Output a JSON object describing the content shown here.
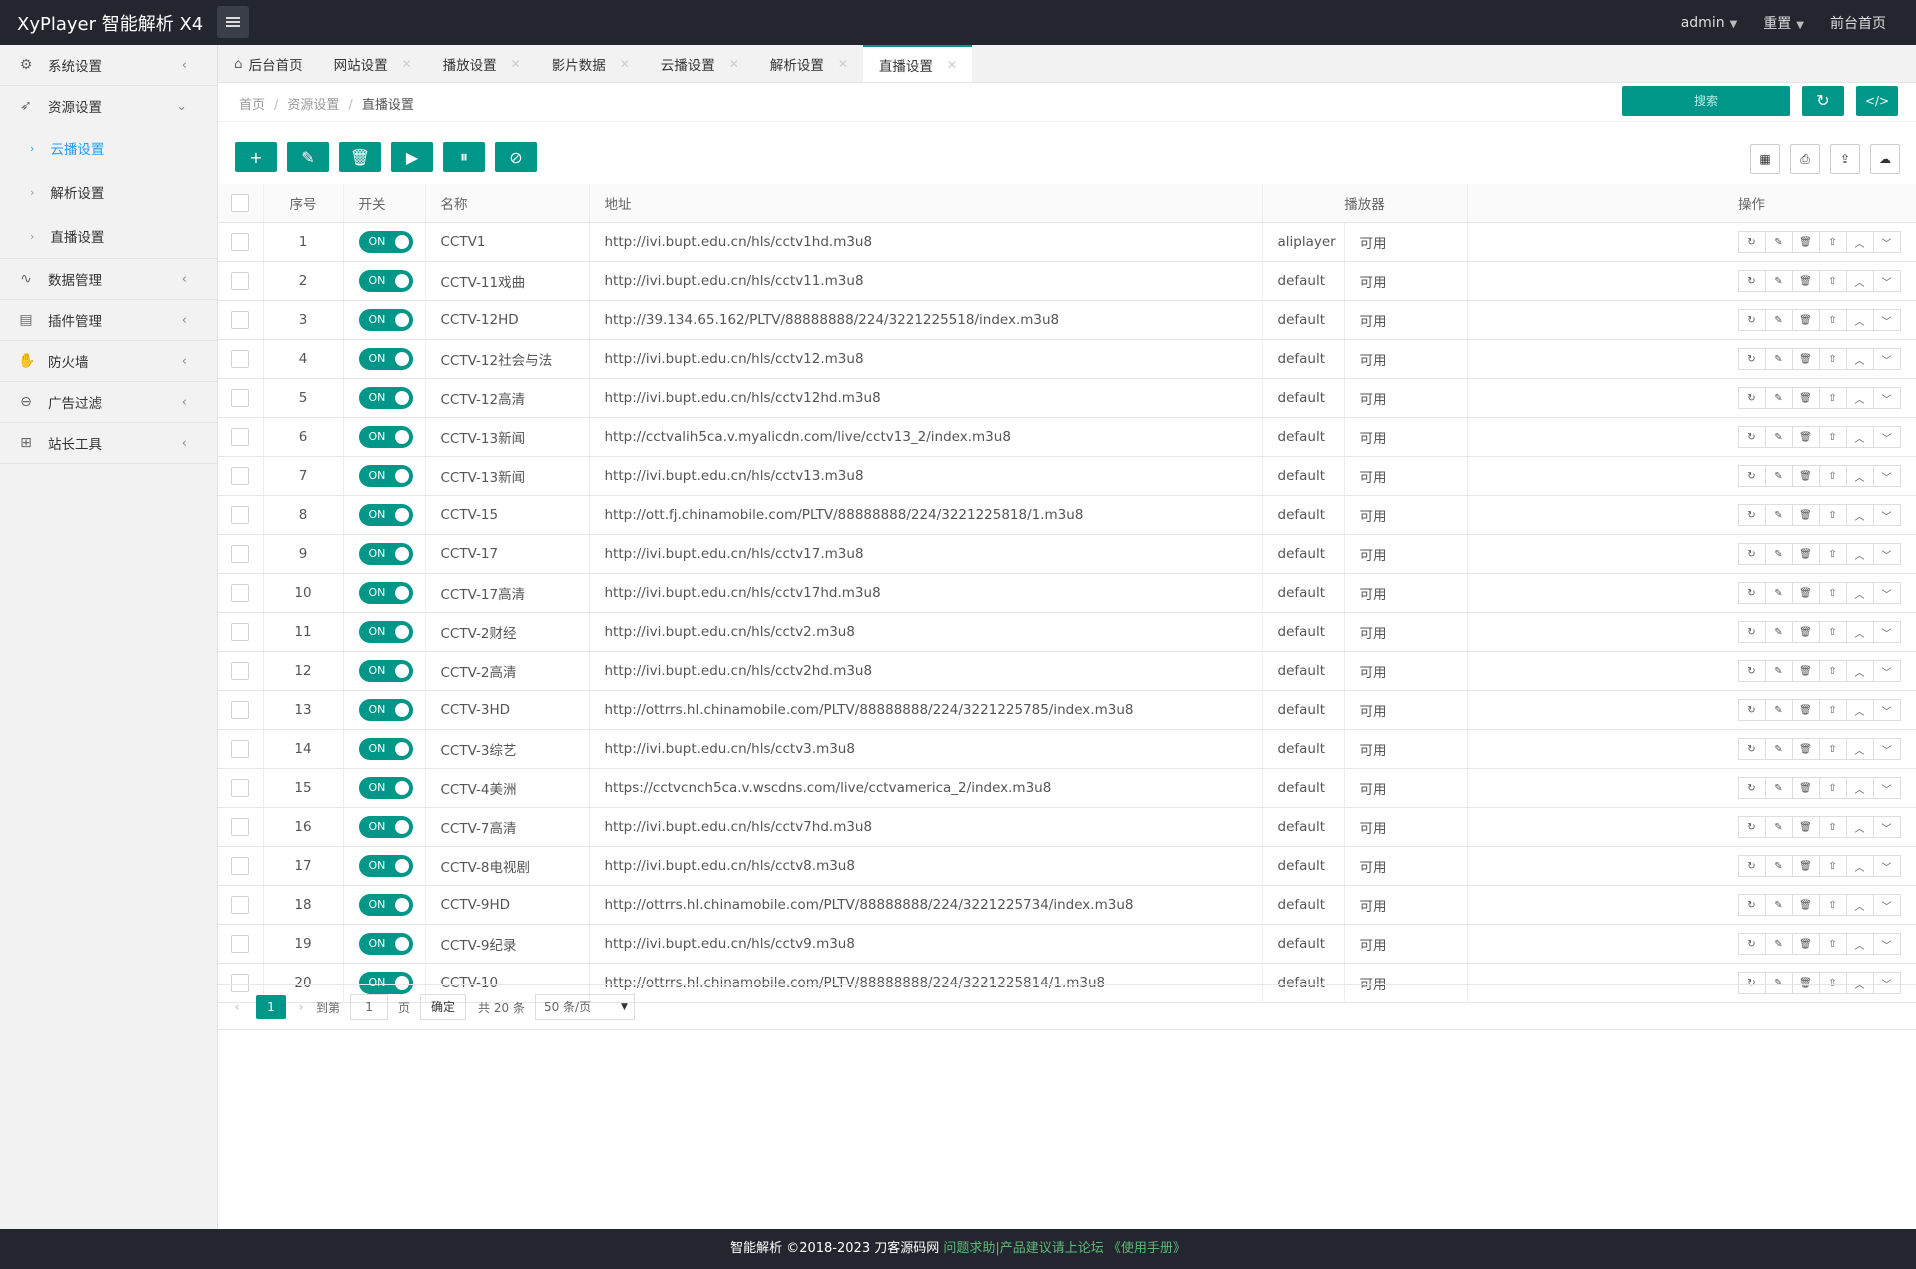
{
  "app": {
    "title": "XyPlayer 智能解析 X4"
  },
  "topnav": {
    "user": "admin",
    "reset": "重置",
    "front": "前台首页"
  },
  "sidebar": {
    "items": [
      {
        "label": "系统设置",
        "icon": "gear-icon"
      },
      {
        "label": "资源设置",
        "icon": "rss-icon"
      },
      {
        "label": "数据管理",
        "icon": "pulse-icon"
      },
      {
        "label": "插件管理",
        "icon": "plugin-icon"
      },
      {
        "label": "防火墙",
        "icon": "fire-icon"
      },
      {
        "label": "广告过滤",
        "icon": "filter-icon"
      },
      {
        "label": "站长工具",
        "icon": "tools-icon"
      }
    ],
    "sub": [
      {
        "label": "云播设置"
      },
      {
        "label": "解析设置"
      },
      {
        "label": "直播设置"
      }
    ]
  },
  "tabs": [
    {
      "label": "后台首页"
    },
    {
      "label": "网站设置"
    },
    {
      "label": "播放设置"
    },
    {
      "label": "影片数据"
    },
    {
      "label": "云播设置"
    },
    {
      "label": "解析设置"
    },
    {
      "label": "直播设置"
    }
  ],
  "breadcrumb": {
    "home": "首页",
    "section": "资源设置",
    "current": "直播设置"
  },
  "search": {
    "label": "搜索"
  },
  "table": {
    "headers": {
      "index": "序号",
      "switch": "开关",
      "name": "名称",
      "url": "地址",
      "player": "播放器",
      "ops": "操作"
    },
    "switch_label": "ON",
    "rows": [
      {
        "n": "1",
        "name": "CCTV1",
        "url": "http://ivi.bupt.edu.cn/hls/cctv1hd.m3u8",
        "player": "aliplayer",
        "status": "可用"
      },
      {
        "n": "2",
        "name": "CCTV-11戏曲",
        "url": "http://ivi.bupt.edu.cn/hls/cctv11.m3u8",
        "player": "default",
        "status": "可用"
      },
      {
        "n": "3",
        "name": "CCTV-12HD",
        "url": "http://39.134.65.162/PLTV/88888888/224/3221225518/index.m3u8",
        "player": "default",
        "status": "可用"
      },
      {
        "n": "4",
        "name": "CCTV-12社会与法",
        "url": "http://ivi.bupt.edu.cn/hls/cctv12.m3u8",
        "player": "default",
        "status": "可用"
      },
      {
        "n": "5",
        "name": "CCTV-12高清",
        "url": "http://ivi.bupt.edu.cn/hls/cctv12hd.m3u8",
        "player": "default",
        "status": "可用"
      },
      {
        "n": "6",
        "name": "CCTV-13新闻",
        "url": "http://cctvalih5ca.v.myalicdn.com/live/cctv13_2/index.m3u8",
        "player": "default",
        "status": "可用"
      },
      {
        "n": "7",
        "name": "CCTV-13新闻",
        "url": "http://ivi.bupt.edu.cn/hls/cctv13.m3u8",
        "player": "default",
        "status": "可用"
      },
      {
        "n": "8",
        "name": "CCTV-15",
        "url": "http://ott.fj.chinamobile.com/PLTV/88888888/224/3221225818/1.m3u8",
        "player": "default",
        "status": "可用"
      },
      {
        "n": "9",
        "name": "CCTV-17",
        "url": "http://ivi.bupt.edu.cn/hls/cctv17.m3u8",
        "player": "default",
        "status": "可用"
      },
      {
        "n": "10",
        "name": "CCTV-17高清",
        "url": "http://ivi.bupt.edu.cn/hls/cctv17hd.m3u8",
        "player": "default",
        "status": "可用"
      },
      {
        "n": "11",
        "name": "CCTV-2财经",
        "url": "http://ivi.bupt.edu.cn/hls/cctv2.m3u8",
        "player": "default",
        "status": "可用"
      },
      {
        "n": "12",
        "name": "CCTV-2高清",
        "url": "http://ivi.bupt.edu.cn/hls/cctv2hd.m3u8",
        "player": "default",
        "status": "可用"
      },
      {
        "n": "13",
        "name": "CCTV-3HD",
        "url": "http://ottrrs.hl.chinamobile.com/PLTV/88888888/224/3221225785/index.m3u8",
        "player": "default",
        "status": "可用"
      },
      {
        "n": "14",
        "name": "CCTV-3综艺",
        "url": "http://ivi.bupt.edu.cn/hls/cctv3.m3u8",
        "player": "default",
        "status": "可用"
      },
      {
        "n": "15",
        "name": "CCTV-4美洲",
        "url": "https://cctvcnch5ca.v.wscdns.com/live/cctvamerica_2/index.m3u8",
        "player": "default",
        "status": "可用"
      },
      {
        "n": "16",
        "name": "CCTV-7高清",
        "url": "http://ivi.bupt.edu.cn/hls/cctv7hd.m3u8",
        "player": "default",
        "status": "可用"
      },
      {
        "n": "17",
        "name": "CCTV-8电视剧",
        "url": "http://ivi.bupt.edu.cn/hls/cctv8.m3u8",
        "player": "default",
        "status": "可用"
      },
      {
        "n": "18",
        "name": "CCTV-9HD",
        "url": "http://ottrrs.hl.chinamobile.com/PLTV/88888888/224/3221225734/index.m3u8",
        "player": "default",
        "status": "可用"
      },
      {
        "n": "19",
        "name": "CCTV-9纪录",
        "url": "http://ivi.bupt.edu.cn/hls/cctv9.m3u8",
        "player": "default",
        "status": "可用"
      },
      {
        "n": "20",
        "name": "CCTV-10",
        "url": "http://ottrrs.hl.chinamobile.com/PLTV/88888888/224/3221225814/1.m3u8",
        "player": "default",
        "status": "可用"
      }
    ]
  },
  "pager": {
    "current": "1",
    "goto": "到第",
    "page_input": "1",
    "page_unit": "页",
    "confirm": "确定",
    "total": "共 20 条",
    "per_page": "50 条/页"
  },
  "footer": {
    "copyright": "智能解析 ©2018-2023 刀客源码网",
    "help": "问题求助|产品建议请上论坛",
    "manual": "《使用手册》"
  },
  "colors": {
    "accent": "#009688",
    "topbar": "#23262e",
    "link_active": "#1e9fff"
  }
}
